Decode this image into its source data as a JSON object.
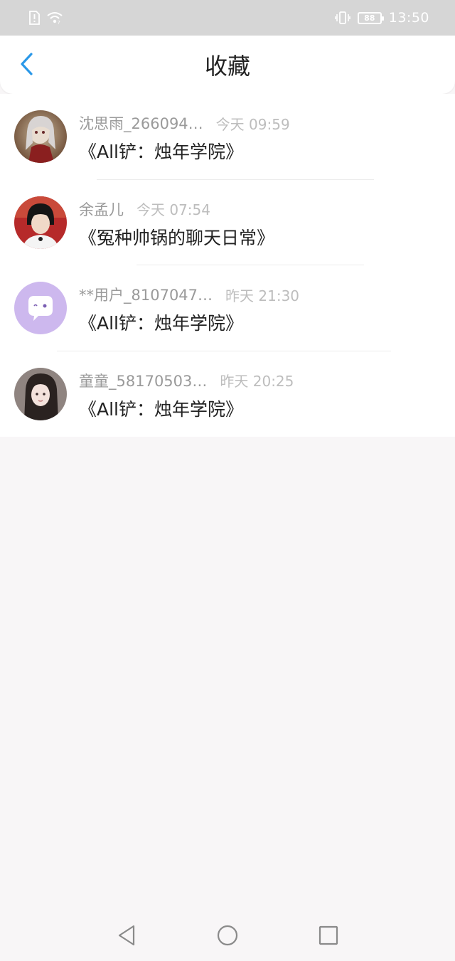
{
  "status_bar": {
    "time": "13:50",
    "battery": "88",
    "icons": [
      "alert-sim-icon",
      "wifi-icon",
      "vibrate-icon",
      "battery-icon"
    ]
  },
  "header": {
    "title": "收藏",
    "back_icon": "chevron-left-icon"
  },
  "colors": {
    "accent": "#2a98e8",
    "status_bar_bg": "#d6d6d6",
    "page_bg": "#f8f6f7"
  },
  "items": [
    {
      "username": "沈思雨_266094…",
      "time": "今天 09:59",
      "title": "《All铲：烛年学院》",
      "avatar": "avatar-anime-girl"
    },
    {
      "username": "余孟儿",
      "time": "今天 07:54",
      "title": "《冤种帅锅的聊天日常》",
      "avatar": "avatar-boy-photo"
    },
    {
      "username": "**用户_8107047…",
      "time": "昨天 21:30",
      "title": "《All铲：烛年学院》",
      "avatar": "avatar-default-chat"
    },
    {
      "username": "童童_58170503…",
      "time": "昨天 20:25",
      "title": "《All铲：烛年学院》",
      "avatar": "avatar-girl-photo"
    }
  ],
  "nav_bar": {
    "icons": [
      "back-triangle-icon",
      "home-circle-icon",
      "recents-square-icon"
    ]
  }
}
